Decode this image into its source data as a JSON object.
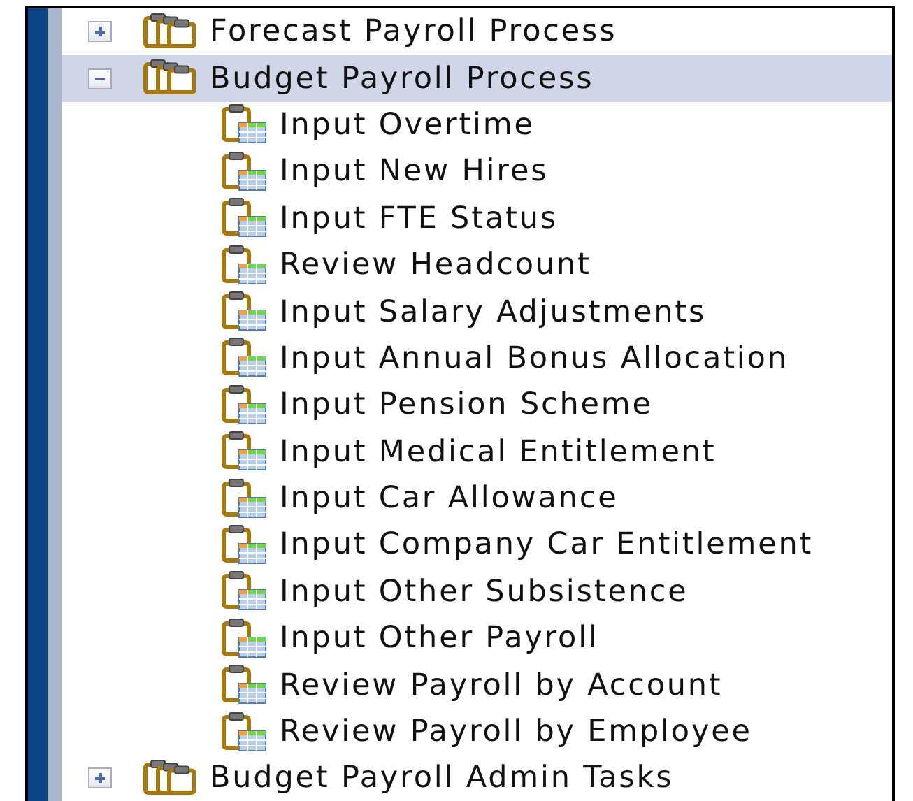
{
  "tree": [
    {
      "label": "Forecast Payroll Process",
      "expanded": false,
      "selected": false
    },
    {
      "label": "Budget Payroll Process",
      "expanded": true,
      "selected": true,
      "children": [
        {
          "label": "Input Overtime"
        },
        {
          "label": "Input New Hires"
        },
        {
          "label": "Input FTE Status"
        },
        {
          "label": "Review Headcount"
        },
        {
          "label": "Input Salary Adjustments"
        },
        {
          "label": "Input Annual Bonus Allocation"
        },
        {
          "label": "Input Pension Scheme"
        },
        {
          "label": "Input Medical Entitlement"
        },
        {
          "label": "Input Car Allowance"
        },
        {
          "label": "Input Company Car Entitlement"
        },
        {
          "label": "Input Other Subsistence"
        },
        {
          "label": "Input Other Payroll"
        },
        {
          "label": "Review Payroll by Account"
        },
        {
          "label": "Review Payroll by Employee"
        }
      ]
    },
    {
      "label": "Budget Payroll Admin Tasks",
      "expanded": false,
      "selected": false
    }
  ]
}
